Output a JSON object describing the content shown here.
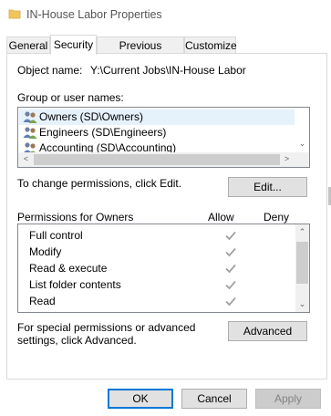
{
  "window": {
    "title": "IN-House Labor Properties"
  },
  "tabs": [
    {
      "label": "General",
      "active": false
    },
    {
      "label": "Security",
      "active": true
    },
    {
      "label": "Previous Versions",
      "active": false
    },
    {
      "label": "Customize",
      "active": false
    }
  ],
  "object": {
    "label": "Object name:",
    "value": "Y:\\Current Jobs\\IN-House Labor"
  },
  "groups": {
    "label": "Group or user names:",
    "items": [
      {
        "name": "Owners (SD\\Owners)",
        "selected": true
      },
      {
        "name": "Engineers (SD\\Engineers)",
        "selected": false
      },
      {
        "name": "Accounting (SD\\Accounting)",
        "selected": false
      }
    ],
    "scroll_down_glyph": "⌄",
    "scroll_left_glyph": "<",
    "scroll_right_glyph": ">"
  },
  "change_permissions": {
    "text": "To change permissions, click Edit.",
    "edit_button": "Edit..."
  },
  "permissions": {
    "header": "Permissions for Owners",
    "allow_header": "Allow",
    "deny_header": "Deny",
    "rows": [
      {
        "name": "Full control",
        "allow": true,
        "deny": false
      },
      {
        "name": "Modify",
        "allow": true,
        "deny": false
      },
      {
        "name": "Read & execute",
        "allow": true,
        "deny": false
      },
      {
        "name": "List folder contents",
        "allow": true,
        "deny": false
      },
      {
        "name": "Read",
        "allow": true,
        "deny": false
      }
    ],
    "scroll_up_glyph": "⌃",
    "scroll_down_glyph": "⌄"
  },
  "special": {
    "text": "For special permissions or advanced settings, click Advanced.",
    "advanced_button": "Advanced"
  },
  "footer": {
    "ok": "OK",
    "cancel": "Cancel",
    "apply": "Apply"
  },
  "colors": {
    "selected_row": "#e5f1fb",
    "checkmark_disabled": "#a0a0a0",
    "primary_border": "#0078d7"
  },
  "icons": {
    "folder": "folder-icon",
    "users": "users-group-icon",
    "check": "checkmark-icon"
  }
}
